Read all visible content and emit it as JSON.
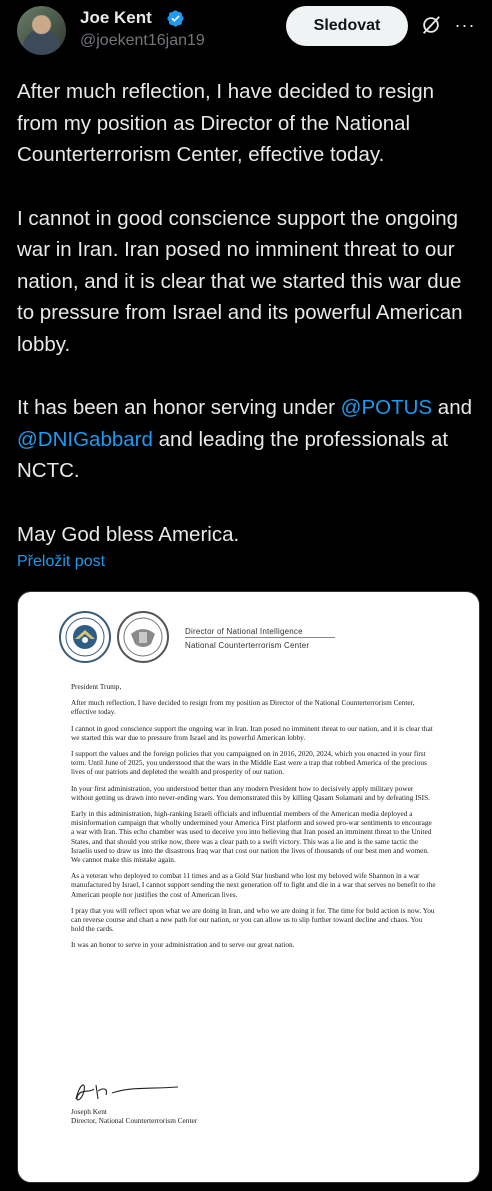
{
  "author": {
    "name": "Joe Kent",
    "handle": "@joekent16jan19"
  },
  "actions": {
    "follow_label": "Sledovat",
    "more": "···"
  },
  "post": {
    "p1": "After much reflection, I have decided to resign from my position as Director of the National Counterterrorism Center, effective today.",
    "p2": "I cannot in good conscience support the ongoing war in Iran. Iran posed no imminent threat to our nation, and it is clear that we started this war due to pressure from Israel and its powerful American lobby.",
    "p3_a": "It has been an honor serving under ",
    "p3_mention1": "@POTUS",
    "p3_b": " and ",
    "p3_mention2": "@DNIGabbard",
    "p3_c": " and leading the professionals at NCTC.",
    "p4": "May God bless America.",
    "translate_label": "Přeložit post"
  },
  "letter": {
    "letterhead_title": "Director of National Intelligence",
    "letterhead_sub": "National Counterterrorism Center",
    "salutation": "President Trump,",
    "paragraphs": [
      "After much reflection, I have decided to resign from my position as Director of the National Counterterrorism Center, effective today.",
      "I cannot in good conscience support the ongoing war in Iran. Iran posed no imminent threat to our nation, and it is clear that we started this war due to pressure from Israel and its powerful American lobby.",
      "I support the values and the foreign policies that you campaigned on in 2016, 2020, 2024, which you enacted in your first term. Until June of 2025, you understood that the wars in the Middle East were a trap that robbed America of the precious lives of our patriots and depleted the wealth and prosperity of our nation.",
      "In your first administration, you understood better than any modern President how to decisively apply military power without getting us drawn into never-ending wars. You demonstrated this by killing Qasam Solamani and by defeating ISIS.",
      "Early in this administration, high-ranking Israeli officials and influential members of the American media deployed a misinformation campaign that wholly undermined your America First platform and sowed pro-war sentiments to encourage a war with Iran. This echo chamber was used to deceive you into believing that Iran posed an imminent threat to the United States, and that should you strike now, there was a clear path to a swift victory. This was a lie and is the same tactic the Israelis used to draw us into the disastrous Iraq war that cost our nation the lives of thousands of our best men and women. We cannot make this mistake again.",
      "As a veteran who deployed to combat 11 times and as a Gold Star husband who lost my beloved wife Shannon in a war manufactured by Israel, I cannot support sending the next generation off to fight and die in a war that serves no benefit to the American people nor justifies the cost of American lives.",
      "I pray that you will reflect upon what we are doing in Iran, and who we are doing it for. The time for bold action is now. You can reverse course and chart a new path for our nation, or you can allow us to slip further toward decline and chaos. You hold the cards.",
      "It was an honor to serve in your administration and to serve our great nation."
    ],
    "signer_name": "Joseph Kent",
    "signer_title": "Director, National Counterterrorism Center"
  }
}
